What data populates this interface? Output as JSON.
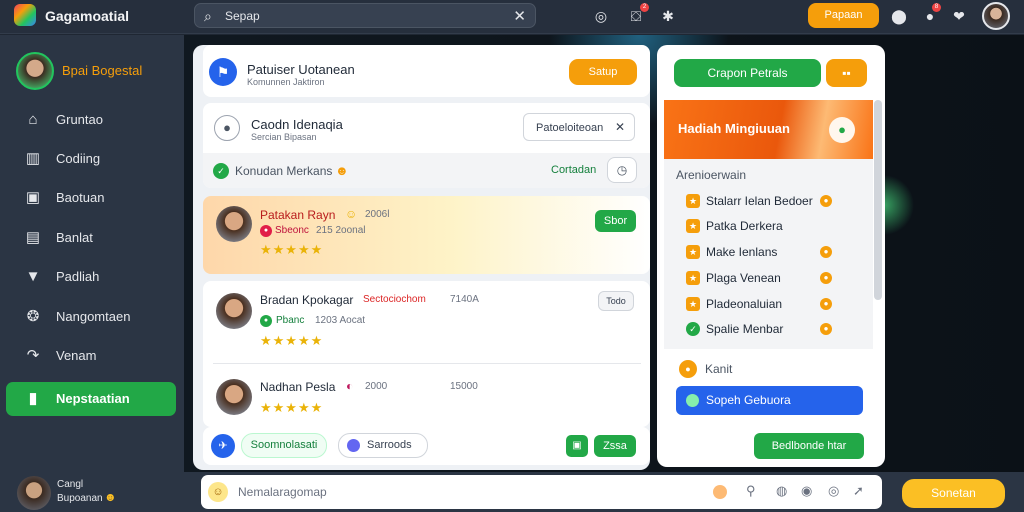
{
  "app": {
    "title": "Gagamoatial"
  },
  "search": {
    "value": "Sepap",
    "placeholder": "Sepap"
  },
  "topbar": {
    "apps_button": "Papaan",
    "notification_badge": "2",
    "avatar_badge": "8",
    "icons": [
      "search-icon",
      "user-add-icon",
      "grid-icon",
      "location-icon",
      "bell-icon",
      "heart-icon"
    ]
  },
  "sidebar": {
    "profile_name": "Bpai Bogestal",
    "items": [
      {
        "label": "Gruntao",
        "icon": "home-icon"
      },
      {
        "label": "Codiing",
        "icon": "bar-chart-icon"
      },
      {
        "label": "Baotuan",
        "icon": "image-icon"
      },
      {
        "label": "Banlat",
        "icon": "document-icon"
      },
      {
        "label": "Padliah",
        "icon": "triangle-icon"
      },
      {
        "label": "Nangomtaen",
        "icon": "layers-icon"
      },
      {
        "label": "Venam",
        "icon": "share-icon"
      },
      {
        "label": "Nepstaatian",
        "icon": "bookmark-icon",
        "active": true
      }
    ],
    "footer_user": {
      "line1": "Cangl",
      "line2": "Bupoanan"
    }
  },
  "feed": {
    "header": {
      "title": "Patuiser Uotanean",
      "subtitle": "Komunnen Jaktiron",
      "button": "Satup"
    },
    "group": {
      "name": "Caodn Idenaqia",
      "subtitle": "Sercian Bipasan",
      "filter_label": "Patoeloiteoan",
      "status_text": "Konudan Merkans",
      "contact_label": "Cortadan"
    },
    "posts": [
      {
        "name": "Patakan Rayn",
        "time": "2006l",
        "tag": "Sbeonc",
        "meta": "215 2oonal",
        "button": "Sbor",
        "rating": "★★★★★"
      },
      {
        "name": "Bradan Kpokagar",
        "location": "Sectociochom",
        "time": "7140A",
        "tag": "Pbanc",
        "meta": "1203 Aocat",
        "button": "Todo",
        "rating": "★★★★★"
      },
      {
        "name": "Nadhan Pesla",
        "time": "2000",
        "extra": "15000",
        "rating": "★★★★★"
      }
    ],
    "footer": {
      "chip1": "Soomnolasati",
      "chip2": "Sarroods",
      "button": "Zssa"
    }
  },
  "promo": {
    "top_button": "Crapon Petrals",
    "banner_title": "Hadiah Mingiuuan"
  },
  "widgets": {
    "section_title": "Arenioerwain",
    "items": [
      "Stalarr Ielan Bedoer",
      "Patka Derkera",
      "Make Ienlans",
      "Plaga Venean",
      "Pladeonaluian",
      "Spalie Menbar"
    ],
    "coin_label": "Kanit",
    "primary_button": "Sopeh Gebuora",
    "bottom_button": "Bedlbonde htar"
  },
  "composer": {
    "placeholder": "Nemalaragomap",
    "send": "Sonetan"
  },
  "colors": {
    "accent_green": "#22a847",
    "accent_orange": "#f59e0b",
    "accent_blue": "#2563eb"
  }
}
